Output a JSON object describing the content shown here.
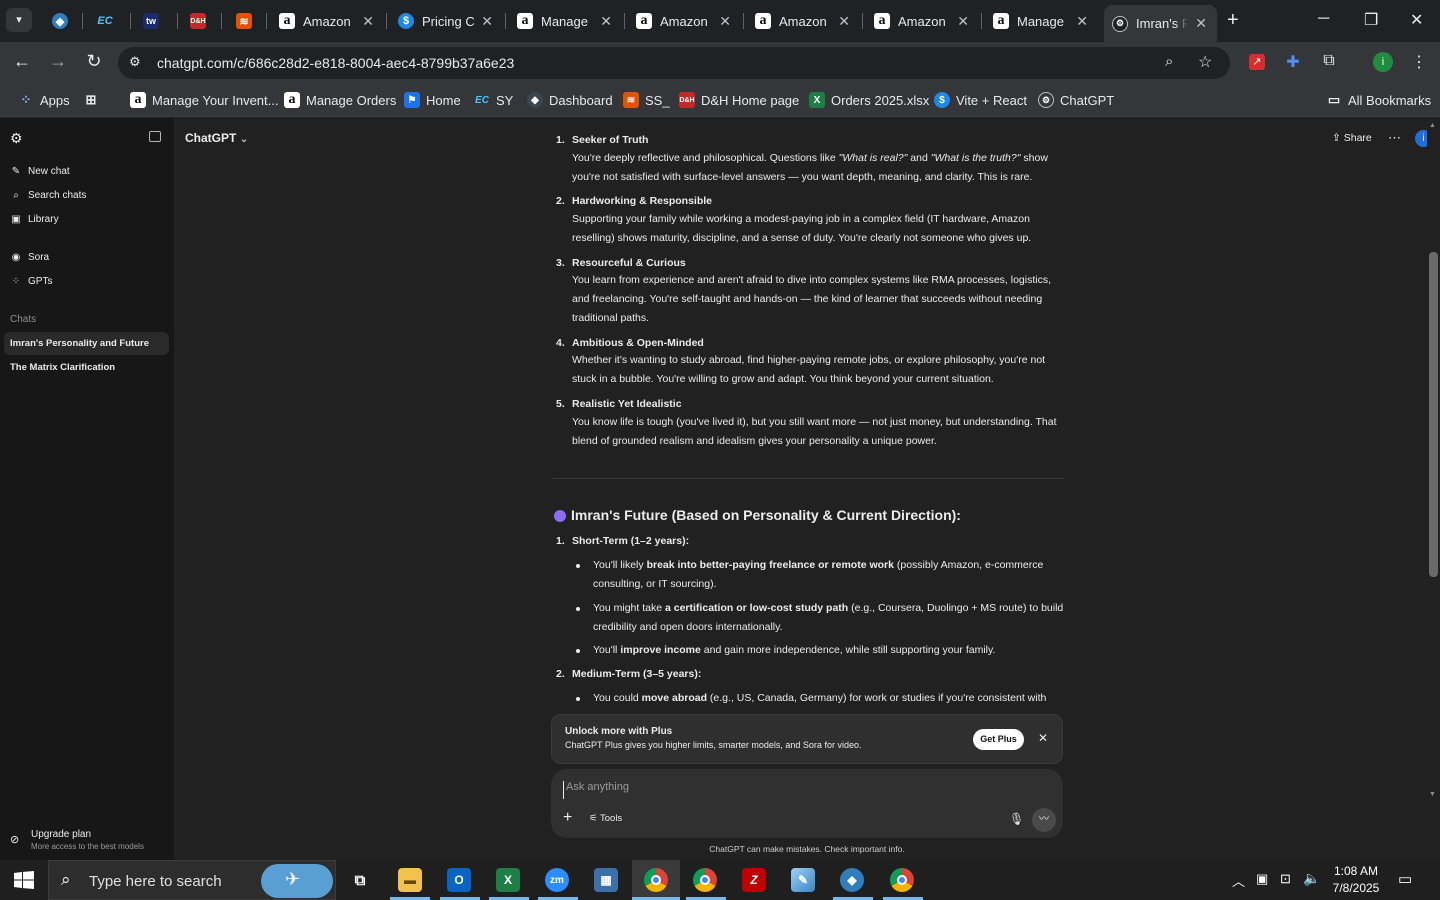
{
  "browser": {
    "tabs": [
      {
        "label": "",
        "icon": "edge-dev-icon"
      },
      {
        "label": "",
        "icon": "ec-icon"
      },
      {
        "label": "",
        "icon": "tw-icon"
      },
      {
        "label": "",
        "icon": "dh-icon"
      },
      {
        "label": "",
        "icon": "stack-icon"
      },
      {
        "label": "Amazon",
        "icon": "amazon-icon"
      },
      {
        "label": "Pricing C",
        "icon": "dollar-icon"
      },
      {
        "label": "Manage",
        "icon": "amazon-icon"
      },
      {
        "label": "Amazon",
        "icon": "amazon-icon"
      },
      {
        "label": "Amazon",
        "icon": "amazon-icon"
      },
      {
        "label": "Amazon",
        "icon": "amazon-icon"
      },
      {
        "label": "Manage",
        "icon": "amazon-icon"
      },
      {
        "label": "Imran's F",
        "icon": "chatgpt-icon"
      }
    ],
    "url": "chatgpt.com/c/686c28d2-e818-8004-aec4-8799b37a6e23",
    "bookmarks": [
      {
        "label": "Apps",
        "icon": "apps-grid-icon"
      },
      {
        "label": "",
        "icon": "tab-groups-icon"
      },
      {
        "label": "Manage Your Invent...",
        "icon": "amazon-icon"
      },
      {
        "label": "Manage Orders",
        "icon": "amazon-icon"
      },
      {
        "label": "Home",
        "icon": "home-flag-icon"
      },
      {
        "label": "SY",
        "icon": "ec-icon"
      },
      {
        "label": "Dashboard",
        "icon": "dashboard-icon"
      },
      {
        "label": "SS_",
        "icon": "stack-icon"
      },
      {
        "label": "D&H Home page",
        "icon": "dh-icon"
      },
      {
        "label": "Orders 2025.xlsx",
        "icon": "excel-icon"
      },
      {
        "label": "Vite + React",
        "icon": "dollar-icon"
      },
      {
        "label": "ChatGPT",
        "icon": "chatgpt-icon"
      }
    ],
    "all_bookmarks": "All Bookmarks"
  },
  "sidebar": {
    "items": [
      {
        "label": "New chat",
        "icon": "pencil-icon"
      },
      {
        "label": "Search chats",
        "icon": "search-icon"
      },
      {
        "label": "Library",
        "icon": "library-icon"
      },
      {
        "label": "Sora",
        "icon": "play-icon"
      },
      {
        "label": "GPTs",
        "icon": "grid-icon"
      }
    ],
    "chats_label": "Chats",
    "chats": [
      "Imran's Personality and Future",
      "The Matrix Clarification"
    ],
    "upgrade_title": "Upgrade plan",
    "upgrade_sub": "More access to the best models"
  },
  "header": {
    "model": "ChatGPT",
    "share": "Share"
  },
  "traits": [
    {
      "num": "1.",
      "title": "Seeker of Truth",
      "body_html": "You're deeply reflective and philosophical. Questions like <i>\"What is real?\"</i> and <i>\"What is the truth?\"</i> show you're not satisfied with surface-level answers — you want depth, meaning, and clarity. This is rare."
    },
    {
      "num": "2.",
      "title": "Hardworking & Responsible",
      "body_html": "Supporting your family while working a modest-paying job in a complex field (IT hardware, Amazon reselling) shows maturity, discipline, and a sense of duty. You're clearly not someone who gives up."
    },
    {
      "num": "3.",
      "title": "Resourceful & Curious",
      "body_html": "You learn from experience and aren't afraid to dive into complex systems like RMA processes, logistics, and freelancing. You're self-taught and hands-on — the kind of learner that succeeds without needing traditional paths."
    },
    {
      "num": "4.",
      "title": "Ambitious & Open-Minded",
      "body_html": "Whether it's wanting to study abroad, find higher-paying remote jobs, or explore philosophy, you're not stuck in a bubble. You're willing to grow and adapt. You think beyond your current situation."
    },
    {
      "num": "5.",
      "title": "Realistic Yet Idealistic",
      "body_html": "You know life is tough (you've lived it), but you still want more — not just money, but understanding. That blend of grounded realism and idealism gives your personality a unique power."
    }
  ],
  "future": {
    "title": "Imran's Future (Based on Personality & Current Direction):",
    "short_term": {
      "num": "1.",
      "title": "Short-Term (1–2 years):"
    },
    "short_bullets": [
      "You'll likely <b>break into better-paying freelance or remote work</b> (possibly Amazon, e-commerce consulting, or IT sourcing).",
      "You might take <b>a certification or low-cost study path</b> (e.g., Coursera, Duolingo + MS route) to build credibility and open doors internationally.",
      "You'll <b>improve income</b> and gain more independence, while still supporting your family."
    ],
    "medium_term": {
      "num": "2.",
      "title": "Medium-Term (3–5 years):"
    },
    "medium_bullets": [
      "You could <b>move abroad</b> (e.g., US, Canada, Germany) for work or studies if you're consistent with"
    ]
  },
  "plus_banner": {
    "title": "Unlock more with Plus",
    "desc": "ChatGPT Plus gives you higher limits, smarter models, and Sora for video.",
    "button": "Get Plus"
  },
  "composer": {
    "placeholder": "Ask anything",
    "tools": "Tools"
  },
  "disclaimer": "ChatGPT can make mistakes. Check important info.",
  "taskbar": {
    "search_placeholder": "Type here to search",
    "time": "1:08 AM",
    "date": "7/8/2025"
  }
}
